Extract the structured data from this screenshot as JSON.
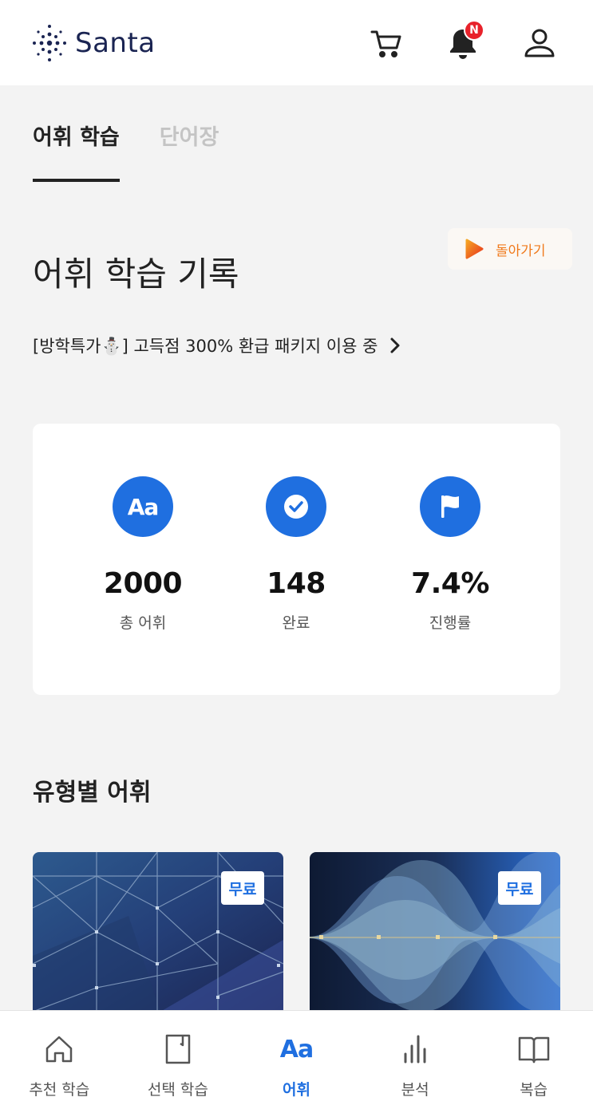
{
  "header": {
    "logo_text": "Santa",
    "cart_icon": "cart-icon",
    "bell_icon": "bell-icon",
    "notification_badge": "N",
    "profile_icon": "user-icon"
  },
  "tabs": [
    {
      "label": "어휘 학습",
      "active": true
    },
    {
      "label": "단어장",
      "active": false
    }
  ],
  "page_title": "어휘 학습 기록",
  "back_button": {
    "label": "돌아가기",
    "icon": "play-icon"
  },
  "package_link": {
    "text": "[방학특가⛄] 고득점 300% 환급 패키지 이용 중",
    "icon": "chevron-right-icon"
  },
  "stats": [
    {
      "icon": "aa-icon",
      "icon_text": "Aa",
      "value": "2000",
      "label": "총 어휘"
    },
    {
      "icon": "check-icon",
      "value": "148",
      "label": "완료"
    },
    {
      "icon": "flag-icon",
      "value": "7.4%",
      "label": "진행률"
    }
  ],
  "section_title": "유형별 어휘",
  "category_cards": [
    {
      "badge": "무료"
    },
    {
      "badge": "무료"
    }
  ],
  "bottom_nav": [
    {
      "label": "추천 학습",
      "icon": "home-icon",
      "active": false
    },
    {
      "label": "선택 학습",
      "icon": "book-page-icon",
      "active": false
    },
    {
      "label": "어휘",
      "icon": "aa-icon",
      "icon_text": "Aa",
      "active": true
    },
    {
      "label": "분석",
      "icon": "bar-chart-icon",
      "active": false
    },
    {
      "label": "복습",
      "icon": "open-book-icon",
      "active": false
    }
  ],
  "colors": {
    "accent": "#1f6fe0",
    "orange": "#f07a1c",
    "badge_red": "#e8222b"
  }
}
